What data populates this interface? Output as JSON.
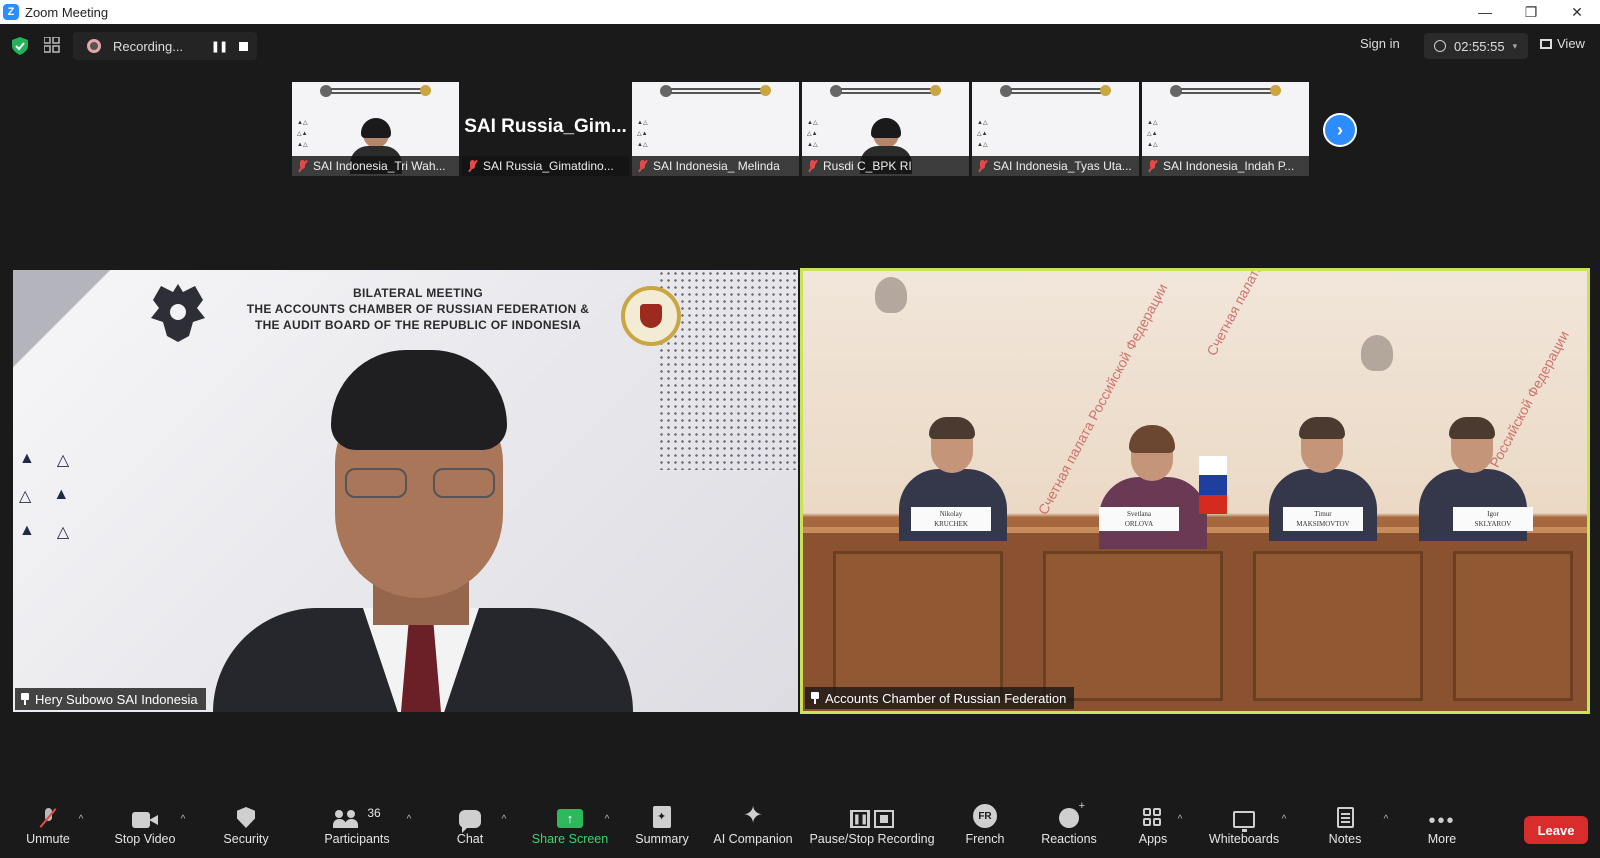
{
  "window": {
    "title": "Zoom Meeting",
    "logo_letter": "Z",
    "minimize_glyph": "—",
    "maximize_glyph": "❐",
    "close_glyph": "✕"
  },
  "topbar": {
    "recording_text": "Recording...",
    "sign_in": "Sign in",
    "timer": "02:55:55",
    "view_label": "View",
    "caret": "▾"
  },
  "slide": {
    "line1": "BILATERAL MEETING",
    "line2": "THE ACCOUNTS CHAMBER OF RUSSIAN FEDERATION &",
    "line3": "THE AUDIT BOARD OF THE REPUBLIC OF INDONESIA"
  },
  "thumbnails": [
    {
      "name": "SAI Indonesia_Tri Wah...",
      "kind": "slide-person"
    },
    {
      "name": "SAI Russia_Gimatdino...",
      "kind": "text",
      "big_text": "SAI  Russia_Gim..."
    },
    {
      "name": "SAI Indonesia_ Melinda",
      "kind": "slide"
    },
    {
      "name": "Rusdi C_BPK RI",
      "kind": "slide-person"
    },
    {
      "name": "SAI Indonesia_Tyas Uta...",
      "kind": "slide"
    },
    {
      "name": "SAI Indonesia_Indah P...",
      "kind": "slide"
    }
  ],
  "next_page_glyph": "›",
  "tiles": {
    "left_name": "Hery Subowo SAI Indonesia",
    "right_name": "Accounts Chamber of Russian Federation"
  },
  "nameplates": [
    {
      "first": "Nikolay",
      "last": "KRUCHEK"
    },
    {
      "first": "Svetlana",
      "last": "ORLOVA"
    },
    {
      "first": "Timur",
      "last": "MAKSIMOVTOV"
    },
    {
      "first": "Igor",
      "last": "SKLYAROV"
    }
  ],
  "flag_colors": [
    "#ffffff",
    "#1c3fa0",
    "#d52b1e"
  ],
  "toolbar": {
    "unmute": "Unmute",
    "stop_video": "Stop Video",
    "security": "Security",
    "participants": "Participants",
    "participants_count": "36",
    "chat": "Chat",
    "share_screen": "Share Screen",
    "summary": "Summary",
    "ai_companion": "AI Companion",
    "pause_stop_recording": "Pause/Stop Recording",
    "french": "French",
    "french_badge": "FR",
    "reactions": "Reactions",
    "apps": "Apps",
    "whiteboards": "Whiteboards",
    "notes": "Notes",
    "more": "More",
    "leave": "Leave",
    "caret_up": "^"
  },
  "colors": {
    "accent_blue": "#2d8cff",
    "active_speaker_border": "#c8e35a",
    "leave_red": "#d92c2c",
    "share_green": "#2eb85c"
  }
}
